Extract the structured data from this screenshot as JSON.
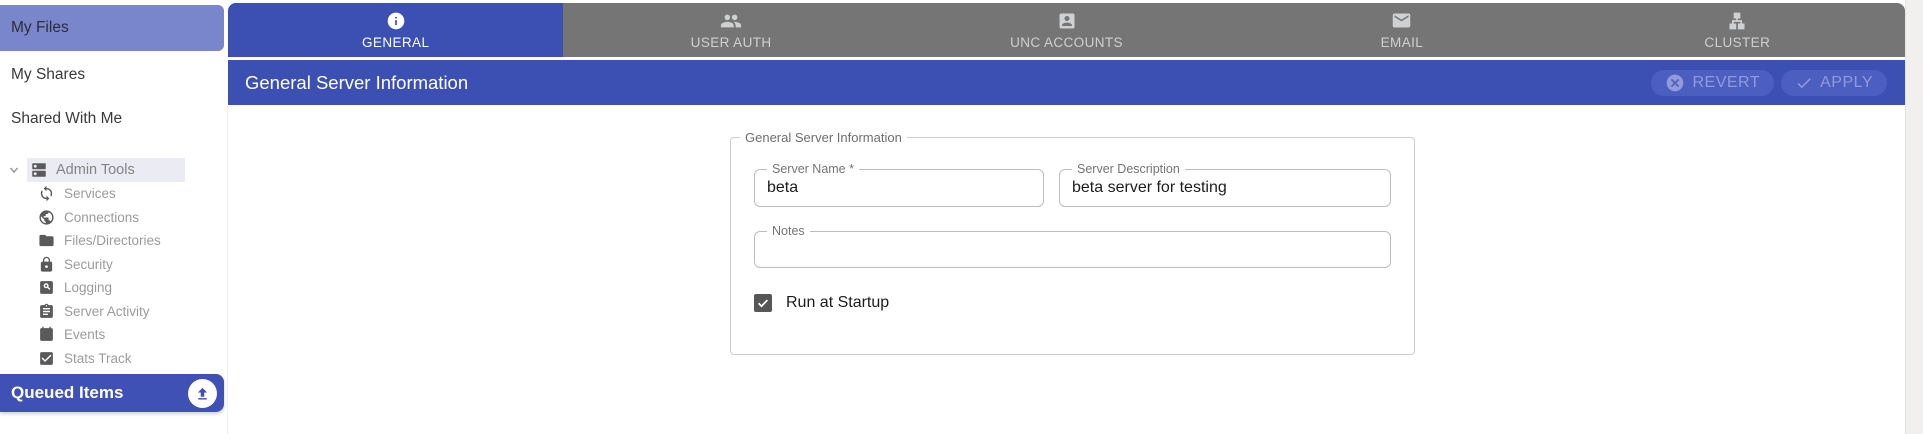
{
  "sidebar": {
    "items": [
      {
        "label": "My Files",
        "active": true
      },
      {
        "label": "My Shares",
        "active": false
      },
      {
        "label": "Shared With Me",
        "active": false
      }
    ],
    "tree": {
      "root": {
        "label": "Admin Tools",
        "icon": "dns-icon",
        "expanded": true
      },
      "children": [
        {
          "label": "Services",
          "icon": "sync-icon"
        },
        {
          "label": "Connections",
          "icon": "globe-icon"
        },
        {
          "label": "Files/Directories",
          "icon": "folder-icon"
        },
        {
          "label": "Security",
          "icon": "lock-icon"
        },
        {
          "label": "Logging",
          "icon": "page-search-icon"
        },
        {
          "label": "Server Activity",
          "icon": "clipboard-icon"
        },
        {
          "label": "Events",
          "icon": "calendar-icon"
        },
        {
          "label": "Stats Track",
          "icon": "check-box-icon"
        }
      ]
    },
    "queued_items": {
      "label": "Queued Items",
      "icon": "cloud-upload-icon"
    }
  },
  "tabs": [
    {
      "label": "GENERAL",
      "icon": "info-icon",
      "active": true
    },
    {
      "label": "USER AUTH",
      "icon": "people-icon",
      "active": false
    },
    {
      "label": "UNC ACCOUNTS",
      "icon": "account-box-icon",
      "active": false
    },
    {
      "label": "EMAIL",
      "icon": "email-icon",
      "active": false
    },
    {
      "label": "CLUSTER",
      "icon": "cluster-icon",
      "active": false
    }
  ],
  "header": {
    "title": "General Server Information",
    "revert_label": "REVERT",
    "apply_label": "APPLY"
  },
  "form": {
    "legend": "General Server Information",
    "server_name": {
      "label": "Server Name *",
      "value": "beta"
    },
    "server_description": {
      "label": "Server Description",
      "value": "beta server for testing"
    },
    "notes": {
      "label": "Notes",
      "value": ""
    },
    "run_at_startup": {
      "label": "Run at Startup",
      "checked": true
    }
  },
  "colors": {
    "primary": "#3c50b4",
    "primary_light": "#7986cb",
    "queued_bar": "#3f51b5",
    "tab_inactive": "#757575",
    "tab_inactive_text": "#cfd0d1",
    "button_pill": "#4d5ec1",
    "button_text": "#8f9bda",
    "tree_highlight": "#ebebf3",
    "checkbox_fill": "#575757"
  }
}
